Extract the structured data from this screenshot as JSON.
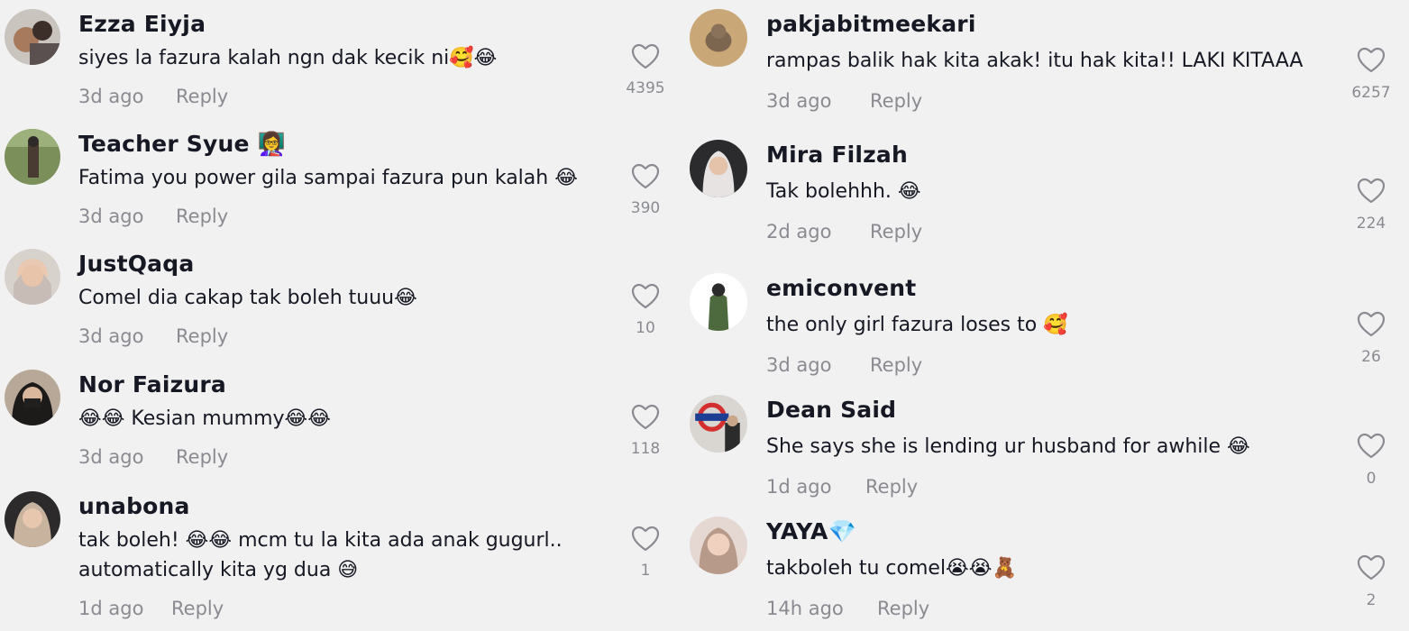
{
  "colors": {
    "background": "#f1f1f2",
    "text": "#161823",
    "muted": "#8a8b91"
  },
  "left": [
    {
      "username": "Ezza Eiyja",
      "lines": [
        "siyes la fazura kalah ngn dak kecik ni🥰😂"
      ],
      "time": "3d ago",
      "reply": "Reply",
      "likes": "4395"
    },
    {
      "username": "Teacher Syue 👩‍🏫",
      "lines": [
        "Fatima you power gila sampai fazura pun kalah 😂"
      ],
      "time": "3d ago",
      "reply": "Reply",
      "likes": "390"
    },
    {
      "username": "JustQaqa",
      "lines": [
        "Comel dia cakap tak boleh tuuu😂"
      ],
      "time": "3d ago",
      "reply": "Reply",
      "likes": "10"
    },
    {
      "username": "Nor Faizura",
      "lines": [
        "😂😂 Kesian mummy😂😂"
      ],
      "time": "3d ago",
      "reply": "Reply",
      "likes": "118"
    },
    {
      "username": "unabona",
      "lines": [
        "tak boleh! 😂😂 mcm tu la kita ada anak gugurl..",
        "automatically kita yg dua 😅"
      ],
      "time": "1d ago",
      "reply": "Reply",
      "likes": "1"
    }
  ],
  "right": [
    {
      "username": "pakjabitmeekari",
      "lines": [
        "rampas balik hak kita akak! itu hak kita!! LAKI KITAAA"
      ],
      "time": "3d ago",
      "reply": "Reply",
      "likes": "6257"
    },
    {
      "username": "Mira Filzah",
      "lines": [
        "Tak bolehhh. 😂"
      ],
      "time": "2d ago",
      "reply": "Reply",
      "likes": "224"
    },
    {
      "username": "emiconvent",
      "lines": [
        "the only girl fazura loses to 🥰"
      ],
      "time": "3d ago",
      "reply": "Reply",
      "likes": "26"
    },
    {
      "username": "Dean Said",
      "lines": [
        "She says she is lending ur husband for awhile 😂"
      ],
      "time": "1d ago",
      "reply": "Reply",
      "likes": "0"
    },
    {
      "username": "YAYA💎",
      "lines": [
        "takboleh tu comel😭😭🧸"
      ],
      "time": "14h ago",
      "reply": "Reply",
      "likes": "2"
    }
  ]
}
